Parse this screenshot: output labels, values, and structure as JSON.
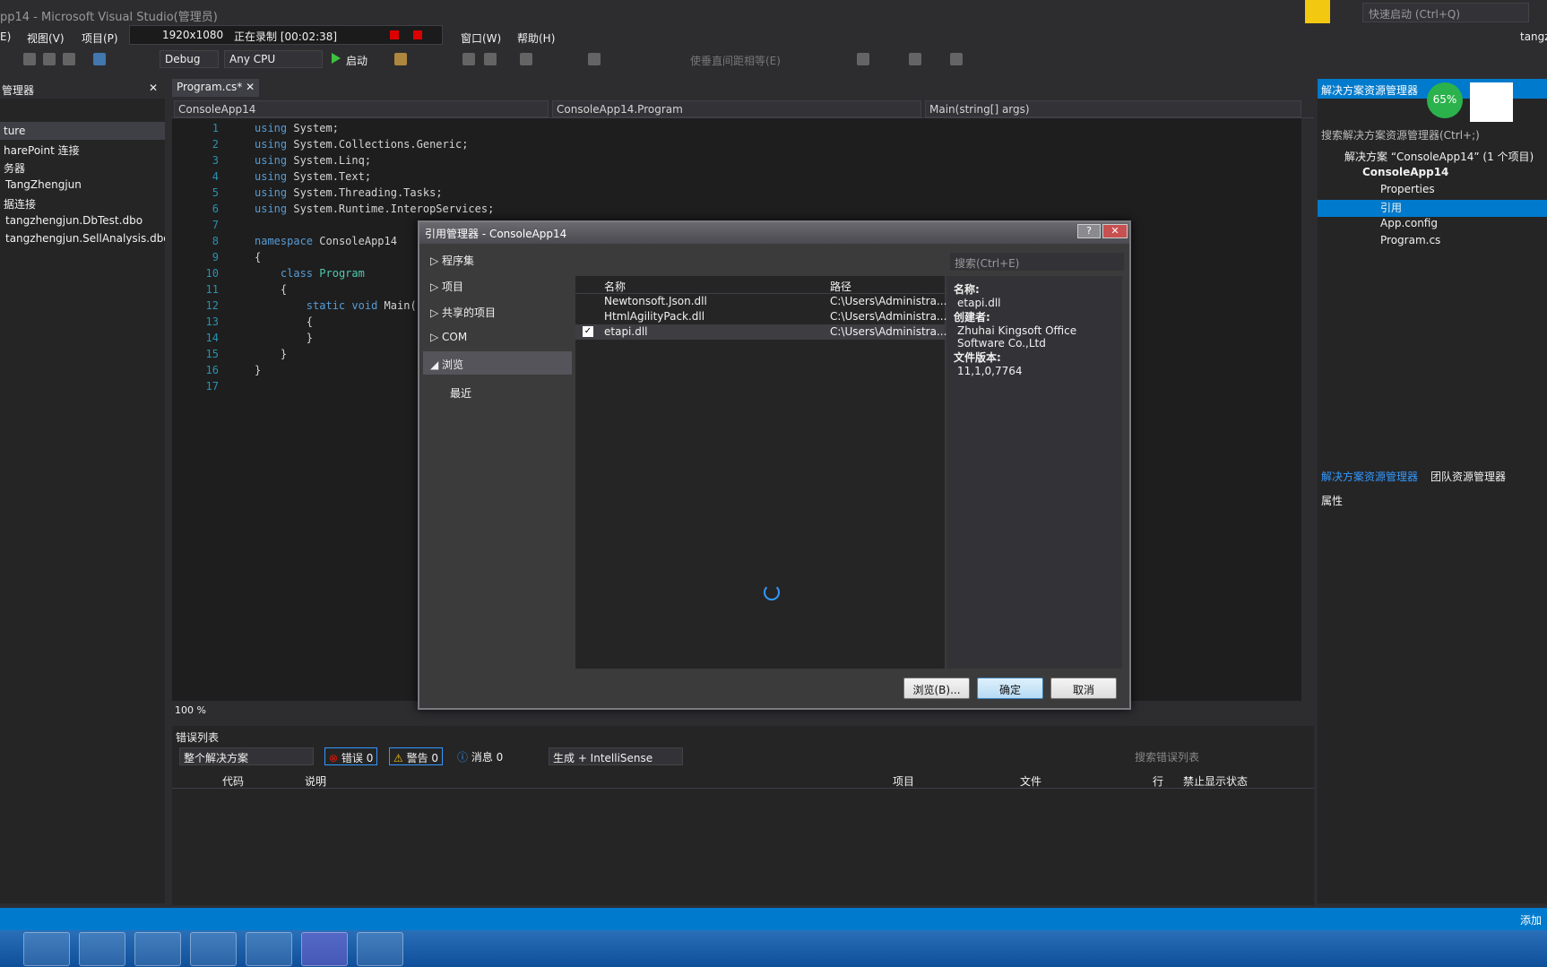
{
  "window": {
    "title": "pp14 - Microsoft Visual Studio(管理员)"
  },
  "menu": {
    "view": "视图(V)",
    "project": "项目(P)",
    "window": "窗口(W)",
    "help": "帮助(H)",
    "edit_partial": "E)"
  },
  "recorder": {
    "resolution": "1920x1080",
    "status": "正在录制 [00:02:38]"
  },
  "toolbar": {
    "config": "Debug",
    "platform": "Any CPU",
    "start": "启动",
    "spacing_cmd": "使垂直间距相等(E)",
    "quick_launch": "快速启动 (Ctrl+Q)",
    "user": "tangz"
  },
  "left_panel": {
    "title": "管理器",
    "items": [
      "ture",
      "harePoint 连接",
      "务器",
      "TangZhengjun",
      "据连接",
      "tangzhengjun.DbTest.dbo",
      "tangzhengjun.SellAnalysis.dbo"
    ]
  },
  "editor": {
    "tab": "Program.cs*",
    "nav_project": "ConsoleApp14",
    "nav_class": "ConsoleApp14.Program",
    "nav_member": "Main(string[] args)",
    "zoom": "100 %",
    "lines": [
      {
        "n": "1",
        "code": "using System;"
      },
      {
        "n": "2",
        "code": "using System.Collections.Generic;"
      },
      {
        "n": "3",
        "code": "using System.Linq;"
      },
      {
        "n": "4",
        "code": "using System.Text;"
      },
      {
        "n": "5",
        "code": "using System.Threading.Tasks;"
      },
      {
        "n": "6",
        "code": "using System.Runtime.InteropServices;"
      },
      {
        "n": "7",
        "code": ""
      },
      {
        "n": "8",
        "code": "namespace ConsoleApp14"
      },
      {
        "n": "9",
        "code": "{"
      },
      {
        "n": "10",
        "code": "    class Program"
      },
      {
        "n": "11",
        "code": "    {"
      },
      {
        "n": "12",
        "code": "        static void Main(string[] a"
      },
      {
        "n": "13",
        "code": "        {"
      },
      {
        "n": "14",
        "code": "        }"
      },
      {
        "n": "15",
        "code": "    }"
      },
      {
        "n": "16",
        "code": "}"
      },
      {
        "n": "17",
        "code": ""
      }
    ]
  },
  "dialog": {
    "title": "引用管理器 - ConsoleApp14",
    "search": "搜索(Ctrl+E)",
    "categories": [
      "程序集",
      "项目",
      "共享的项目",
      "COM",
      "浏览"
    ],
    "recent": "最近",
    "col_name": "名称",
    "col_path": "路径",
    "rows": [
      {
        "name": "Newtonsoft.Json.dll",
        "path": "C:\\Users\\Administra...",
        "checked": false
      },
      {
        "name": "HtmlAgilityPack.dll",
        "path": "C:\\Users\\Administra...",
        "checked": false
      },
      {
        "name": "etapi.dll",
        "path": "C:\\Users\\Administra...",
        "checked": true
      }
    ],
    "details": {
      "name_label": "名称:",
      "name": "etapi.dll",
      "author_label": "创建者:",
      "author1": "Zhuhai Kingsoft Office",
      "author2": "Software Co.,Ltd",
      "version_label": "文件版本:",
      "version": "11,1,0,7764"
    },
    "browse_btn": "浏览(B)...",
    "ok_btn": "确定",
    "cancel_btn": "取消"
  },
  "solution": {
    "title": "解决方案资源管理器",
    "percent": "65%",
    "search": "搜索解决方案资源管理器(Ctrl+;)",
    "root": "解决方案 “ConsoleApp14” (1 个项目)",
    "project": "ConsoleApp14",
    "properties": "Properties",
    "references": "引用",
    "appconfig": "App.config",
    "programcs": "Program.cs",
    "tab1": "解决方案资源管理器",
    "tab2": "团队资源管理器",
    "props_title": "属性"
  },
  "errors": {
    "title": "错误列表",
    "scope": "整个解决方案",
    "errors": "错误 0",
    "warnings": "警告 0",
    "messages": "消息 0",
    "build": "生成 + IntelliSense",
    "search": "搜索错误列表",
    "cols": {
      "code": "代码",
      "desc": "说明",
      "project": "项目",
      "file": "文件",
      "line": "行",
      "suppress": "禁止显示状态"
    }
  },
  "status": {
    "add": "添加"
  }
}
